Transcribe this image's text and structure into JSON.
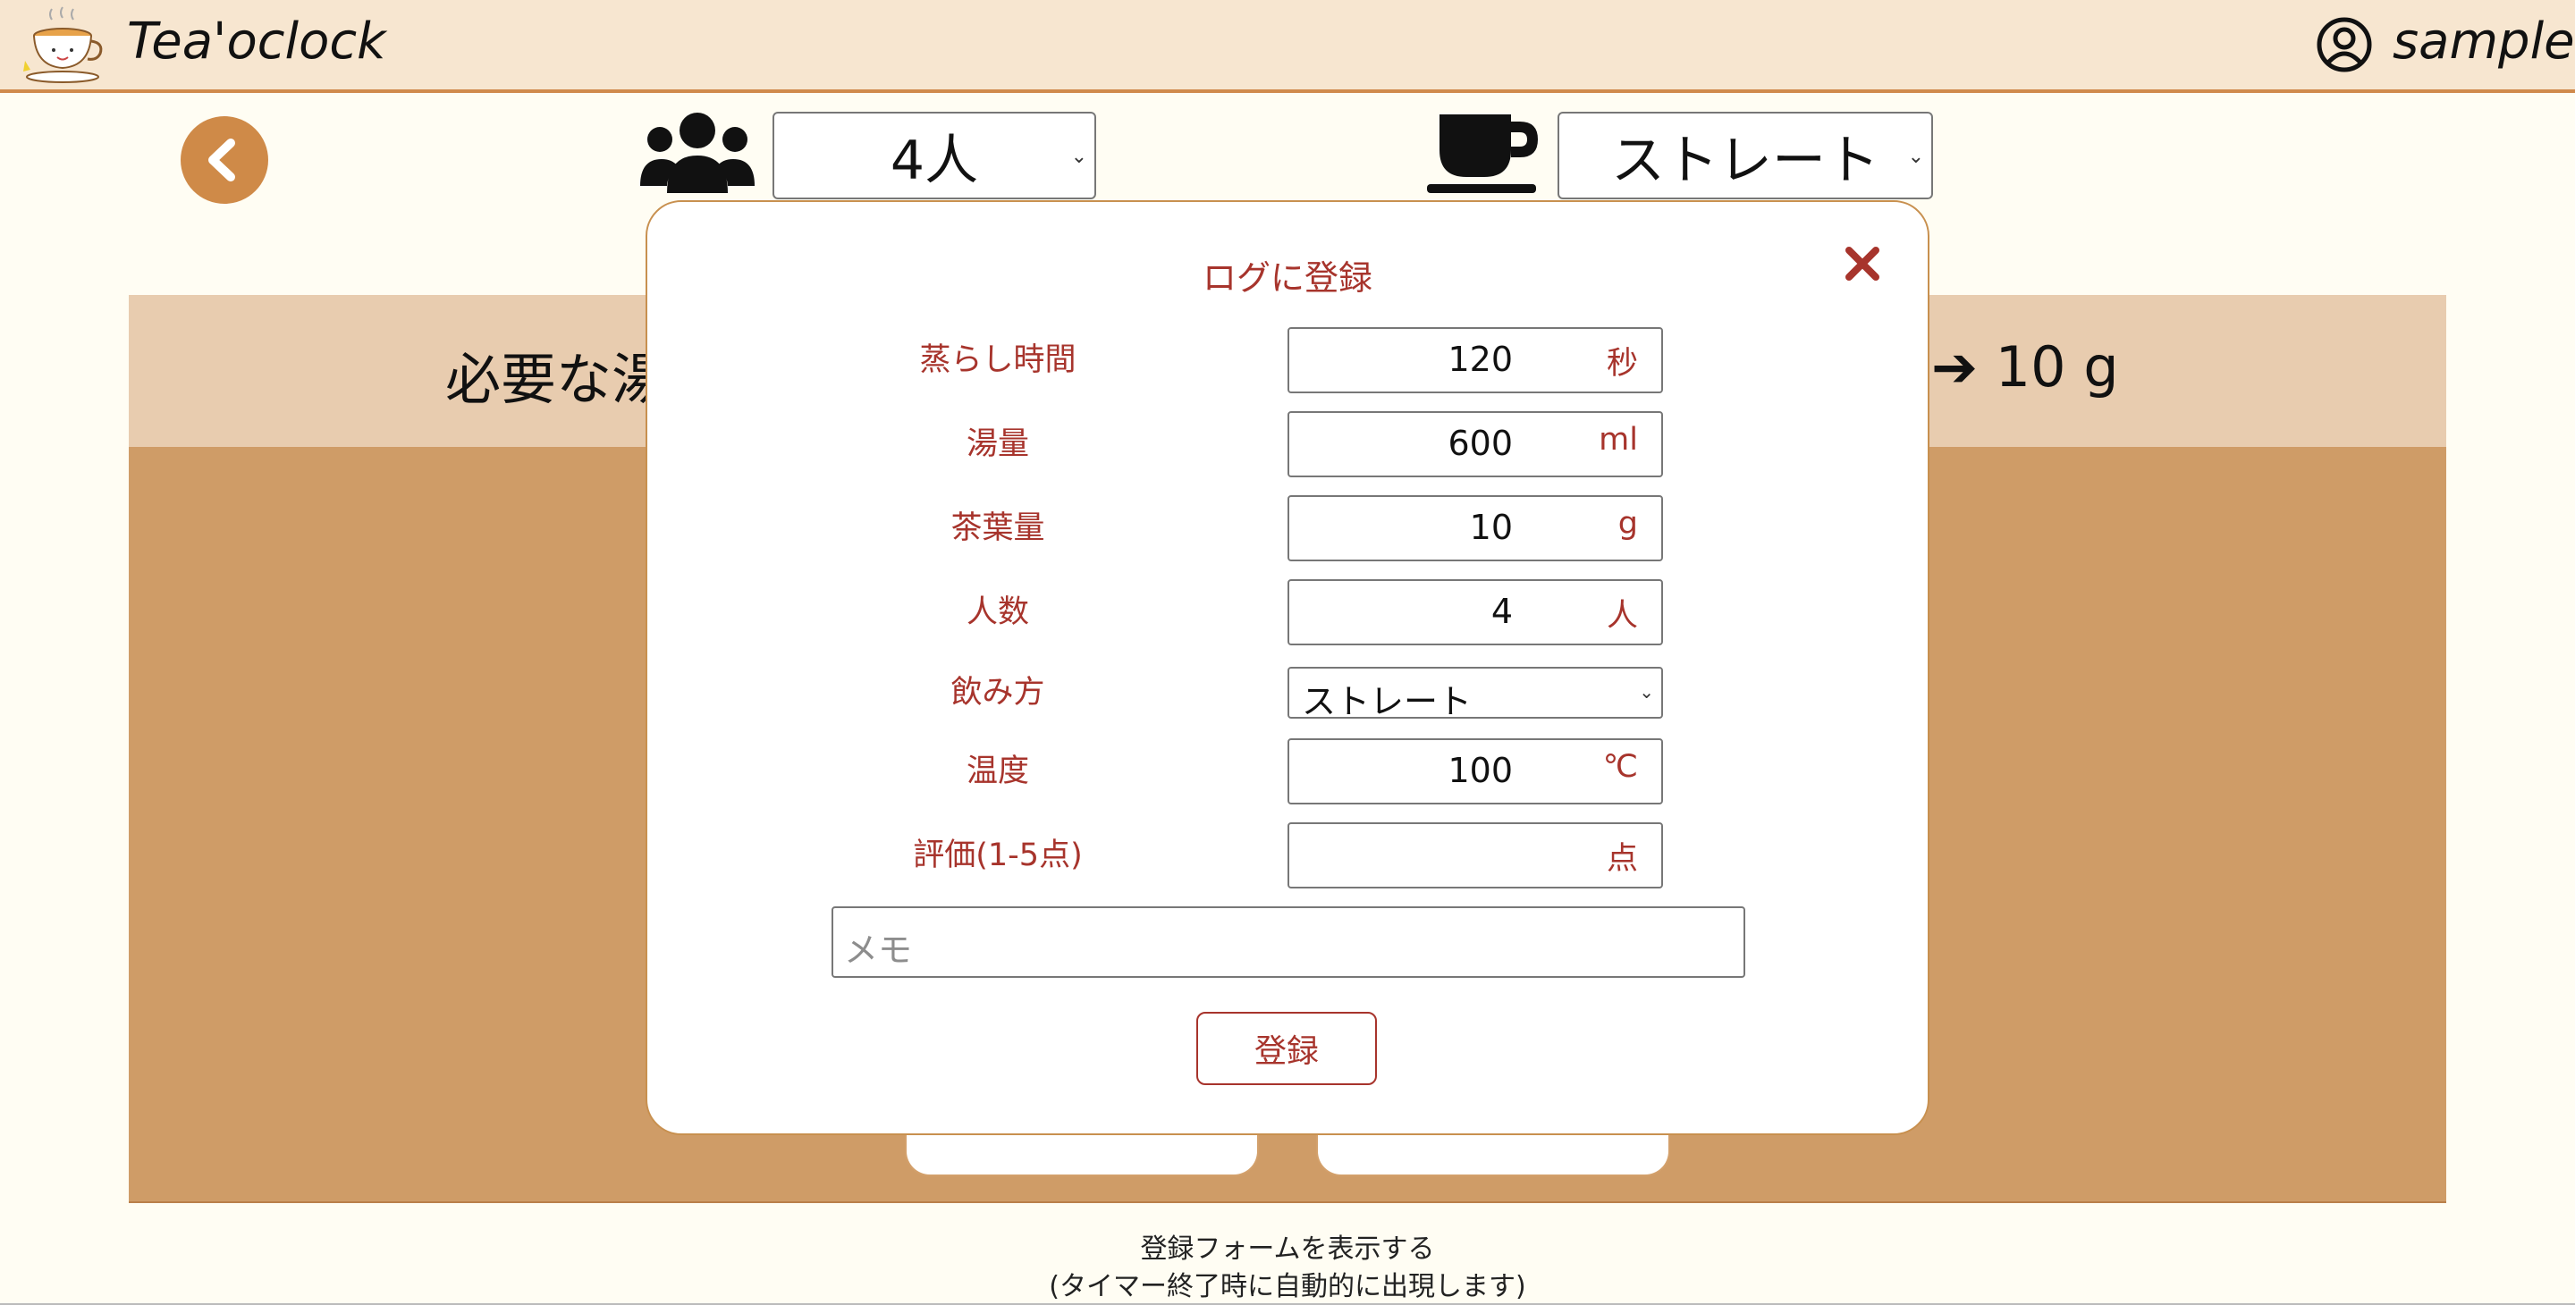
{
  "header": {
    "app_title": "Tea'oclock",
    "username": "sample"
  },
  "toolbar": {
    "people_select_value": "4人",
    "style_select_value": "ストレート"
  },
  "info": {
    "left_text": "必要な湯",
    "right_text": "➔ 10 g"
  },
  "modal": {
    "title": "ログに登録",
    "rows": [
      {
        "label": "蒸らし時間",
        "value": "120",
        "unit": "秒"
      },
      {
        "label": "湯量",
        "value": "600",
        "unit": "ml"
      },
      {
        "label": "茶葉量",
        "value": "10",
        "unit": "g"
      },
      {
        "label": "人数",
        "value": "4",
        "unit": "人"
      },
      {
        "label": "飲み方",
        "value": "ストレート"
      },
      {
        "label": "温度",
        "value": "100",
        "unit": "℃"
      },
      {
        "label": "評価(1-5点)",
        "value": "",
        "unit": "点"
      }
    ],
    "memo_placeholder": "メモ",
    "submit_label": "登録"
  },
  "footer": {
    "line1": "登録フォームを表示する",
    "line2": "(タイマー終了時に自動的に出現します)"
  },
  "colors": {
    "header_bg": "#f7e6d0",
    "accent_orange": "#cf8a48",
    "panel_brown": "#cf9c67",
    "band_beige": "#e8ccaf",
    "modal_red": "#a7342c"
  },
  "icons": [
    "teacup-logo-icon",
    "user-circle-icon",
    "chevron-left-icon",
    "people-icon",
    "coffee-cup-icon",
    "close-icon",
    "chevron-down-icon"
  ]
}
